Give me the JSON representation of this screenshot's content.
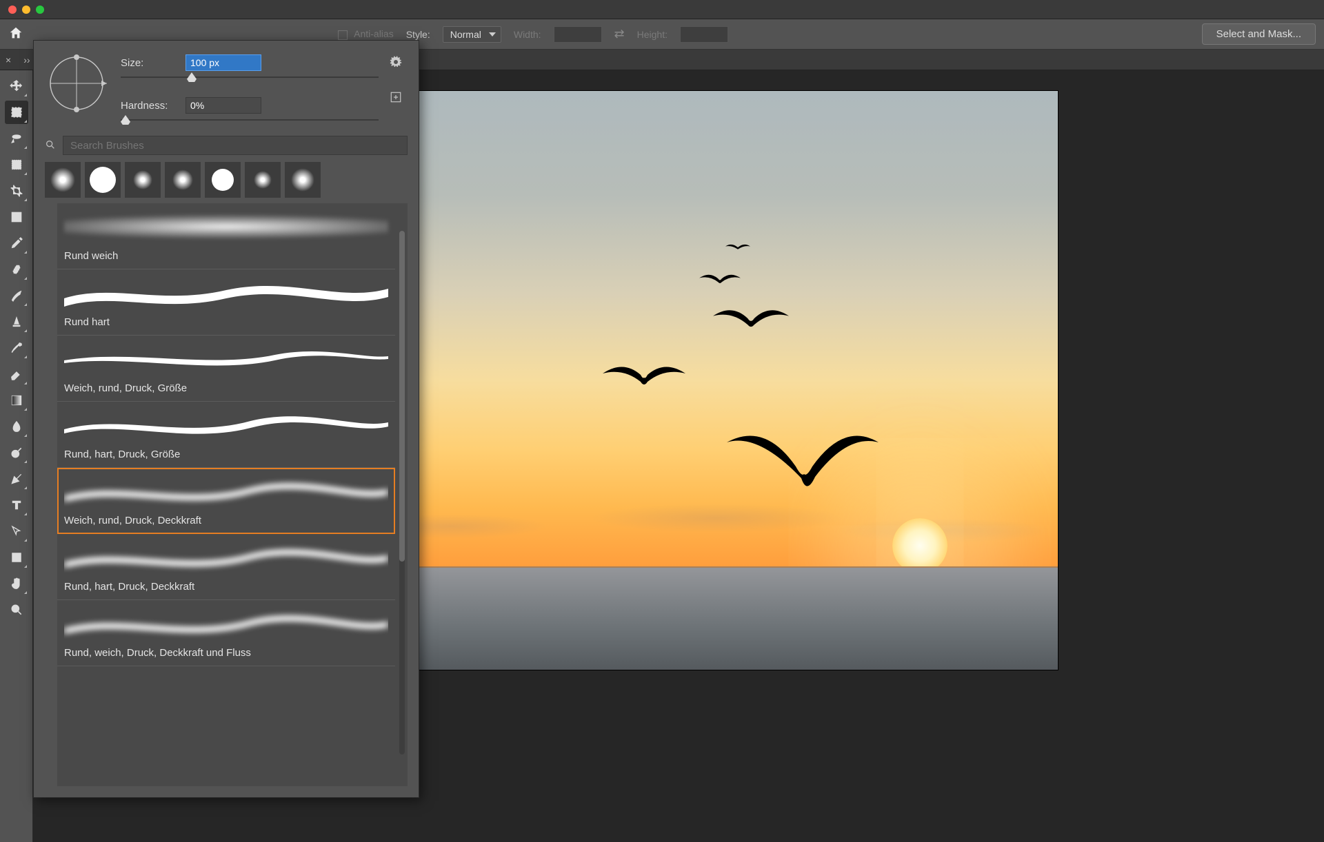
{
  "options": {
    "anti_alias_label": "Anti-alias",
    "style_label": "Style:",
    "style_value": "Normal",
    "width_label": "Width:",
    "height_label": "Height:",
    "select_mask_label": "Select and Mask..."
  },
  "brush_panel": {
    "size_label": "Size:",
    "size_value": "100 px",
    "hardness_label": "Hardness:",
    "hardness_value": "0%",
    "search_placeholder": "Search Brushes",
    "brushes": [
      {
        "label": "Rund weich",
        "style": "soft",
        "selected": false
      },
      {
        "label": "Rund hart",
        "style": "hard",
        "selected": false
      },
      {
        "label": "Weich, rund, Druck, Größe",
        "style": "taper",
        "selected": false
      },
      {
        "label": "Rund, hart, Druck, Größe",
        "style": "hardtaper",
        "selected": false
      },
      {
        "label": "Weich, rund, Druck, Deckkraft",
        "style": "softwave",
        "selected": true
      },
      {
        "label": "Rund, hart, Druck, Deckkraft",
        "style": "softwave",
        "selected": false
      },
      {
        "label": "Rund, weich, Druck, Deckkraft und Fluss",
        "style": "softwave",
        "selected": false
      }
    ]
  }
}
